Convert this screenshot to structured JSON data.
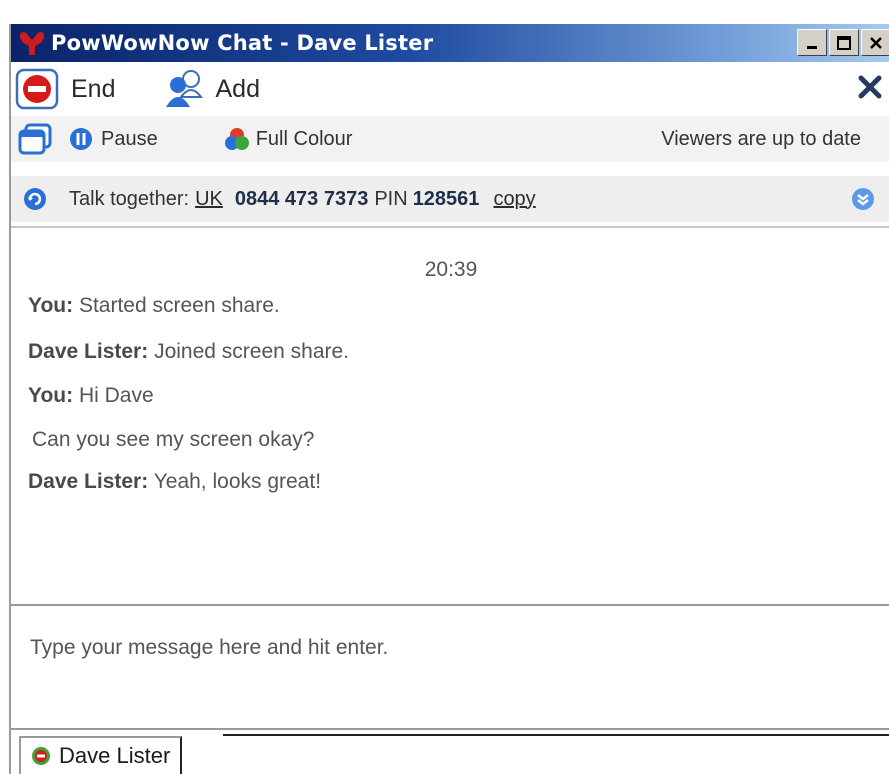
{
  "window": {
    "title": "PowWowNow Chat - Dave Lister",
    "colors": {
      "titlebar_start": "#0a246a",
      "titlebar_end": "#a6caf0",
      "accent_red": "#d21a1a",
      "accent_blue": "#2a6fd6"
    }
  },
  "toolbar": {
    "end_label": "End",
    "add_label": "Add"
  },
  "share_bar": {
    "pause_label": "Pause",
    "colour_label": "Full Colour",
    "status": "Viewers are up to date"
  },
  "talk_bar": {
    "prefix": "Talk together:",
    "country": "UK",
    "number": "0844 473 7373",
    "pin_label": "PIN",
    "pin": "128561",
    "copy_label": "copy"
  },
  "chat": {
    "timestamp": "20:39",
    "messages": [
      {
        "sender": "You:",
        "text": "Started screen share."
      },
      {
        "sender": "Dave Lister:",
        "text": "Joined screen share."
      },
      {
        "sender": "You:",
        "text": "Hi Dave"
      },
      {
        "sender": "",
        "text": "Can you see my screen okay?"
      },
      {
        "sender": "Dave Lister:",
        "text": "Yeah, looks great!"
      }
    ]
  },
  "input": {
    "placeholder": "Type your message here and hit enter."
  },
  "tabs": [
    {
      "label": "Dave Lister"
    }
  ]
}
